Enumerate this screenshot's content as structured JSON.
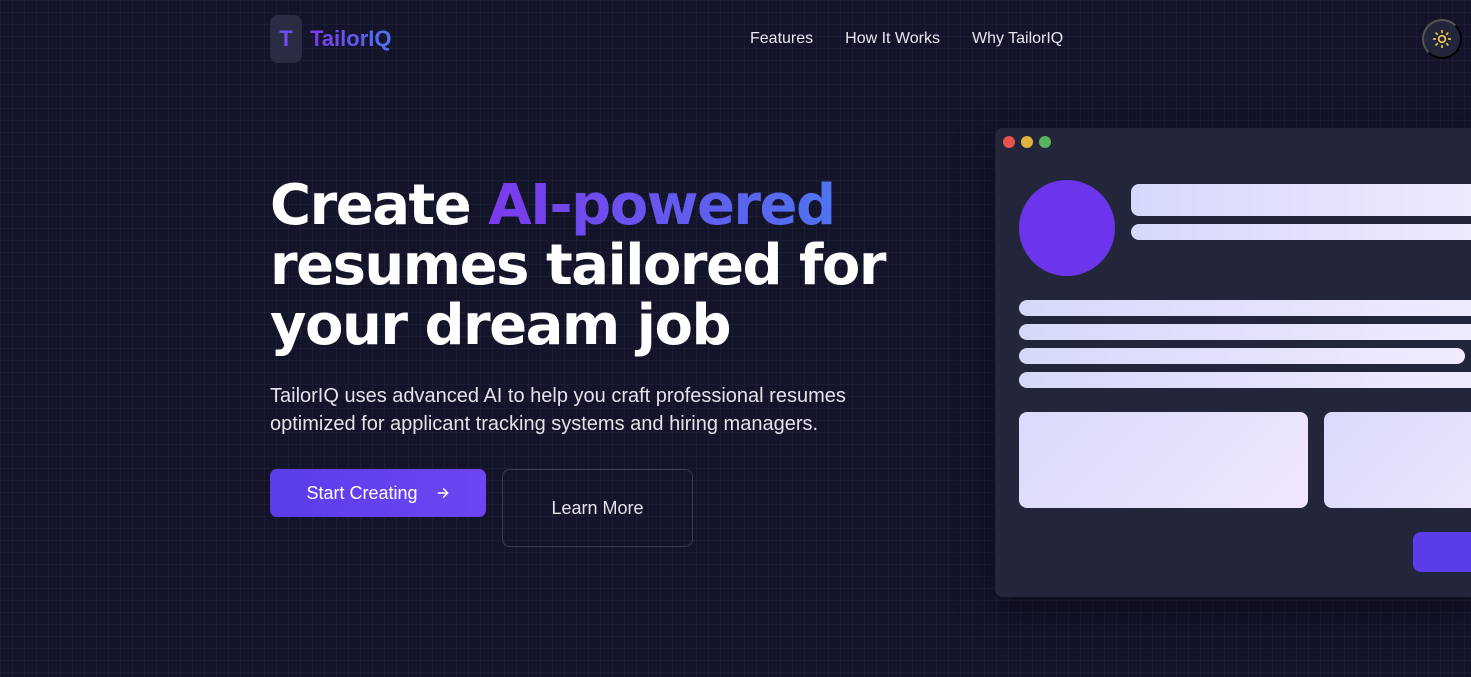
{
  "header": {
    "logo_letter": "T",
    "logo_text": "TailorIQ",
    "nav": [
      {
        "label": "Features"
      },
      {
        "label": "How It Works"
      },
      {
        "label": "Why TailorIQ"
      }
    ],
    "theme_toggle_icon": "sun-icon"
  },
  "hero": {
    "title_prefix": "Create ",
    "title_highlight": "AI-powered",
    "title_rest": "resumes tailored for your dream job",
    "description": "TailorIQ uses advanced AI to help you craft professional resumes optimized for applicant tracking systems and hiring managers.",
    "primary_button": "Start Creating",
    "primary_button_icon": "arrow-right-icon",
    "secondary_button": "Learn More"
  },
  "colors": {
    "background": "#13142a",
    "accent": "#6d45f2",
    "accent_gradient_end": "#4f74f0"
  }
}
